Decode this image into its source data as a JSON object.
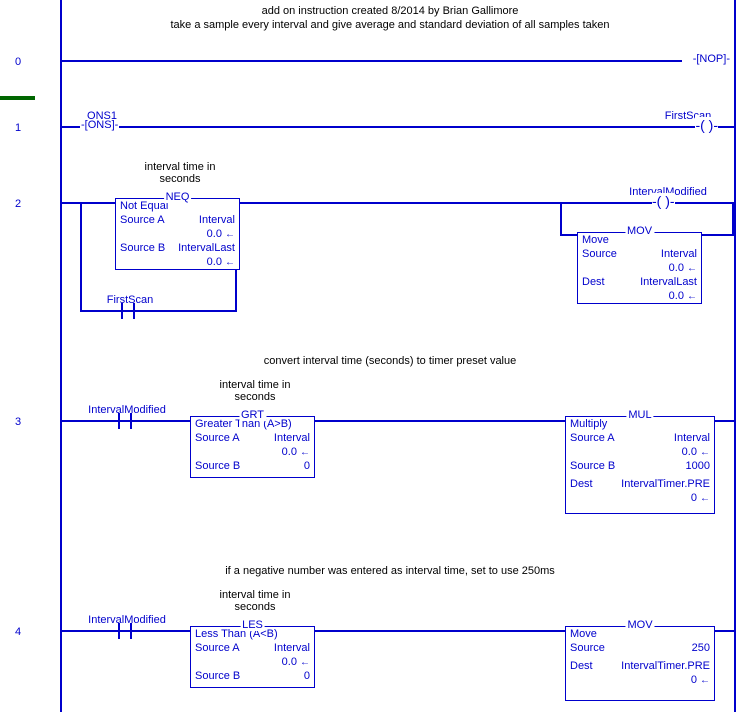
{
  "header": {
    "comment_line1": "add on instruction created 8/2014 by Brian Gallimore",
    "comment_line2": "take a sample every interval and give average and standard deviation of all samples taken"
  },
  "rungs": {
    "r0": {
      "num": "0",
      "out_label": "NOP"
    },
    "r1": {
      "num": "1",
      "left_tag": "ONS1",
      "left_instr": "ONS",
      "right_tag": "FirstScan"
    },
    "r2": {
      "num": "2",
      "box1_comment1": "interval time in",
      "box1_comment2": "seconds",
      "branch_tag": "FirstScan",
      "neq": {
        "header": "NEQ",
        "title": "Not Equal",
        "srcA_lbl": "Source A",
        "srcA_val": "Interval",
        "srcA_num": "0.0",
        "srcB_lbl": "Source B",
        "srcB_val": "IntervalLast",
        "srcB_num": "0.0"
      },
      "right_tag": "IntervalModified",
      "mov": {
        "header": "MOV",
        "title": "Move",
        "src_lbl": "Source",
        "src_val": "Interval",
        "src_num": "0.0",
        "dest_lbl": "Dest",
        "dest_val": "IntervalLast",
        "dest_num": "0.0"
      }
    },
    "r3": {
      "num": "3",
      "rung_comment": "convert interval time (seconds) to timer preset value",
      "box_comment1": "interval time in",
      "box_comment2": "seconds",
      "left_tag": "IntervalModified",
      "grt": {
        "header": "GRT",
        "title": "Greater Than (A>B)",
        "srcA_lbl": "Source A",
        "srcA_val": "Interval",
        "srcA_num": "0.0",
        "srcB_lbl": "Source B",
        "srcB_val": "0"
      },
      "mul": {
        "header": "MUL",
        "title": "Multiply",
        "srcA_lbl": "Source A",
        "srcA_val": "Interval",
        "srcA_num": "0.0",
        "srcB_lbl": "Source B",
        "srcB_val": "1000",
        "dest_lbl": "Dest",
        "dest_val": "IntervalTimer.PRE",
        "dest_num": "0"
      }
    },
    "r4": {
      "num": "4",
      "rung_comment": "if a negative number was entered as interval time, set to use 250ms",
      "box_comment1": "interval time in",
      "box_comment2": "seconds",
      "left_tag": "IntervalModified",
      "les": {
        "header": "LES",
        "title": "Less Than (A<B)",
        "srcA_lbl": "Source A",
        "srcA_val": "Interval",
        "srcA_num": "0.0",
        "srcB_lbl": "Source B",
        "srcB_val": "0"
      },
      "mov": {
        "header": "MOV",
        "title": "Move",
        "src_lbl": "Source",
        "src_val": "250",
        "dest_lbl": "Dest",
        "dest_val": "IntervalTimer.PRE",
        "dest_num": "0"
      }
    }
  }
}
